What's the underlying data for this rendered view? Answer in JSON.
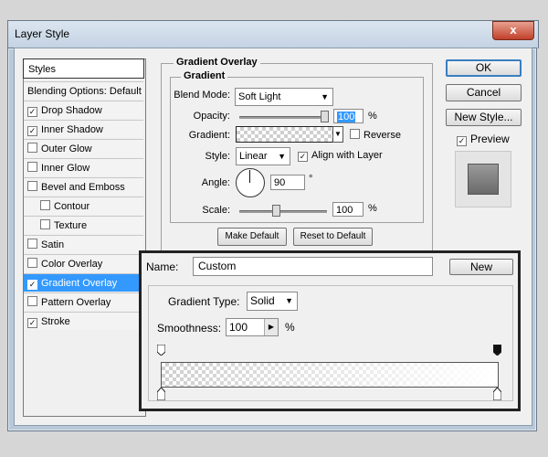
{
  "window": {
    "title": "Layer Style",
    "close_glyph": "x"
  },
  "styles_panel": {
    "header": "Styles",
    "items": [
      {
        "label": "Blending Options: Default",
        "checkbox": false,
        "checked": false,
        "indent": false,
        "selected": false
      },
      {
        "label": "Drop Shadow",
        "checkbox": true,
        "checked": true,
        "indent": false,
        "selected": false
      },
      {
        "label": "Inner Shadow",
        "checkbox": true,
        "checked": true,
        "indent": false,
        "selected": false
      },
      {
        "label": "Outer Glow",
        "checkbox": true,
        "checked": false,
        "indent": false,
        "selected": false
      },
      {
        "label": "Inner Glow",
        "checkbox": true,
        "checked": false,
        "indent": false,
        "selected": false
      },
      {
        "label": "Bevel and Emboss",
        "checkbox": true,
        "checked": false,
        "indent": false,
        "selected": false
      },
      {
        "label": "Contour",
        "checkbox": true,
        "checked": false,
        "indent": true,
        "selected": false
      },
      {
        "label": "Texture",
        "checkbox": true,
        "checked": false,
        "indent": true,
        "selected": false
      },
      {
        "label": "Satin",
        "checkbox": true,
        "checked": false,
        "indent": false,
        "selected": false
      },
      {
        "label": "Color Overlay",
        "checkbox": true,
        "checked": false,
        "indent": false,
        "selected": false
      },
      {
        "label": "Gradient Overlay",
        "checkbox": true,
        "checked": true,
        "indent": false,
        "selected": true
      },
      {
        "label": "Pattern Overlay",
        "checkbox": true,
        "checked": false,
        "indent": false,
        "selected": false
      },
      {
        "label": "Stroke",
        "checkbox": true,
        "checked": true,
        "indent": false,
        "selected": false
      }
    ]
  },
  "gradient_overlay": {
    "section_title": "Gradient Overlay",
    "group_title": "Gradient",
    "blend_mode_label": "Blend Mode:",
    "blend_mode_value": "Soft Light",
    "opacity_label": "Opacity:",
    "opacity_value": "100",
    "opacity_fraction": 1.0,
    "percent": "%",
    "gradient_label": "Gradient:",
    "reverse_label": "Reverse",
    "reverse_checked": false,
    "style_label": "Style:",
    "style_value": "Linear",
    "align_label": "Align with Layer",
    "align_checked": true,
    "angle_label": "Angle:",
    "angle_value": "90",
    "degree": "°",
    "scale_label": "Scale:",
    "scale_value": "100",
    "scale_fraction": 0.4,
    "make_default": "Make Default",
    "reset_default": "Reset to Default"
  },
  "right_buttons": {
    "ok": "OK",
    "cancel": "Cancel",
    "new_style": "New Style...",
    "preview_label": "Preview",
    "preview_checked": true
  },
  "gradient_editor": {
    "name_label": "Name:",
    "name_value": "Custom",
    "new_button": "New",
    "type_label": "Gradient Type:",
    "type_value": "Solid",
    "smoothness_label": "Smoothness:",
    "smoothness_value": "100",
    "percent": "%"
  },
  "icons": {
    "dropdown": "chevron-down-icon",
    "checkmark": "checkmark-icon",
    "stepper": "chevron-right-icon"
  },
  "colors": {
    "selection": "#3399ff",
    "focus_border": "#3a7ec0",
    "overlay_border": "#222222"
  }
}
